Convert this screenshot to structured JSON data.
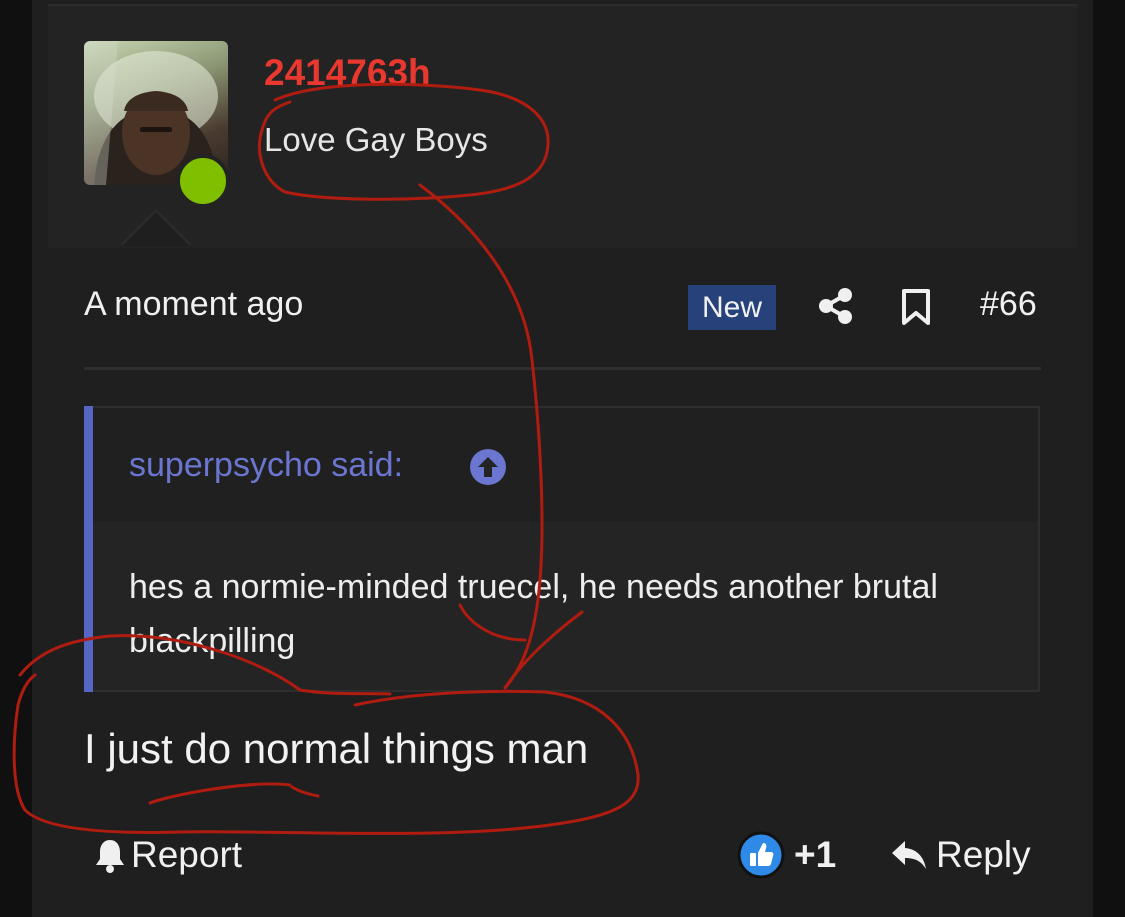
{
  "post": {
    "username": "2414763h",
    "user_title": "Love Gay Boys",
    "time": "A moment ago",
    "new_badge": "New",
    "post_number": "#66",
    "quote": {
      "author_line": "superpsycho said:",
      "text": "hes a normie-minded truecel, he needs another brutal blackpilling"
    },
    "body": "I just do normal things man",
    "actions": {
      "report": "Report",
      "reaction_count": "+1",
      "reply": "Reply"
    }
  },
  "colors": {
    "username": "#e8382f",
    "online": "#7fbf00",
    "badge_bg": "#27427a",
    "quote_accent": "#5666c4",
    "reaction_blue": "#2e8ae6",
    "annotation_ink": "#b01c10"
  },
  "icons": {
    "share": "share-icon",
    "bookmark": "bookmark-icon",
    "quote_jump": "arrow-up-circle-icon",
    "report": "bell-icon",
    "reaction": "thumbs-up-icon",
    "reply": "reply-arrow-icon"
  }
}
